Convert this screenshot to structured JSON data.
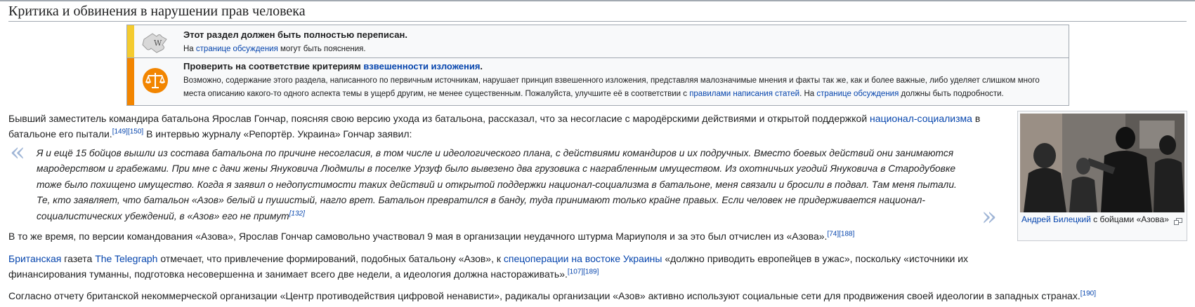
{
  "section": {
    "title": "Критика и обвинения в нарушении прав человека"
  },
  "notices": {
    "rewrite": {
      "title": "Этот раздел должен быть полностью переписан.",
      "line_pre": "На ",
      "line_link": "странице обсуждения",
      "line_post": " могут быть пояснения.",
      "icon": "puzzle-icon",
      "bar_color": "#f4cb2f"
    },
    "pov": {
      "title_pre": "Проверить на соответствие критериям ",
      "title_link": "взвешенности изложения",
      "title_post": ".",
      "body_pre": "Возможно, содержание этого раздела, написанного по первичным источникам, нарушает принцип взвешенного изложения, представляя малозначимые мнения и факты так же, как и более важные, либо уделяет слишком много места описанию какого-то одного аспекта темы в ущерб другим, не менее существенным. Пожалуйста, улучшите её в соответствии с ",
      "body_link1": "правилами написания статей",
      "body_mid": ". На ",
      "body_link2": "странице обсуждения",
      "body_post": " должны быть подробности.",
      "icon": "scales-icon",
      "bar_color": "#f28500"
    }
  },
  "paragraphs": {
    "p1": {
      "pre": "Бывший заместитель командира батальона Ярослав Гончар, поясняя свою версию ухода из батальона, рассказал, что за несогласие с мародёрскими действиями и открытой поддержкой ",
      "link": "национал-социализма",
      "mid": " в батальоне его пытали.",
      "refs": "[149][150]",
      "post": " В интервью журналу «Репортёр. Украина» Гончар заявил:"
    },
    "quote": {
      "text": "Я и ещё 15 бойцов вышли из состава батальона по причине несогласия, в том числе и идеологического плана, с действиями командиров и их подручных. Вместо боевых действий они занимаются мародерством и грабежами. При мне с дачи жены Януковича Людмилы в поселке Урзуф было вывезено два грузовика с награбленным имуществом. Из охотничьих угодий Януковича в Стародубовке тоже было похищено имущество. Когда я заявил о недопустимости таких действий и открытой поддержки национал-социализма в батальоне, меня связали и бросили в подвал. Там меня пытали. Те, кто заявляет, что батальон «Азов» белый и пушистый, нагло врет. Батальон превратился в банду, туда принимают только крайне правых. Если человек не придерживается национал-социалистических убеждений, в «Азов» его не примут",
      "ref": "[132]",
      "open_mark": "«",
      "close_mark": "»"
    },
    "p2": {
      "text": "В то же время, по версии командования «Азова», Ярослав Гончар самовольно участвовал 9 мая в организации неудачного штурма Мариуполя и за это был отчислен из «Азова».",
      "refs": "[74][188]"
    },
    "p3": {
      "link1": "Британская",
      "t1": " газета ",
      "link2": "The Telegraph",
      "t2": " отмечает, что привлечение формирований, подобных батальону «Азов», к ",
      "link3": "спецоперации на востоке Украины",
      "t3": " «должно приводить европейцев в ужас», поскольку «источники их финансирования туманны, подготовка несовершенна и занимает всего две недели, а идеология должна настораживать».",
      "refs": "[107][189]"
    },
    "p4": {
      "text": "Согласно отчету британской некоммерческой организации «Центр противодействия цифровой ненависти», радикалы организации «Азов» активно используют социальные сети для продвижения своей идеологии в западных странах.",
      "refs": "[190]"
    }
  },
  "thumbnail": {
    "caption_link": "Андрей Билецкий",
    "caption_rest": " с бойцами «Азова»",
    "icon": "magnify-icon"
  }
}
